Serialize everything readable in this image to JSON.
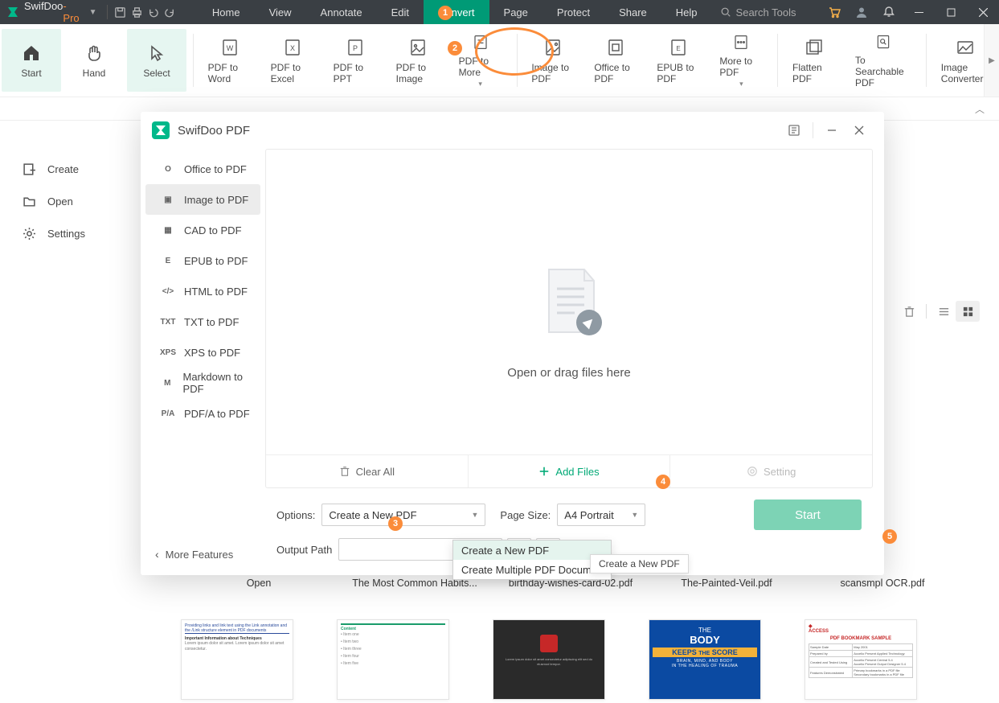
{
  "title": {
    "part1": "SwifDoo",
    "part2": "-Pro"
  },
  "menus": [
    "Home",
    "View",
    "Annotate",
    "Edit",
    "Convert",
    "Page",
    "Protect",
    "Share",
    "Help"
  ],
  "menu_active_index": 4,
  "search_placeholder": "Search Tools",
  "ribbon": {
    "start": "Start",
    "hand": "Hand",
    "select": "Select",
    "items": [
      "PDF to Word",
      "PDF to Excel",
      "PDF to PPT",
      "PDF to Image",
      "PDF to More",
      "Image to PDF",
      "Office to PDF",
      "EPUB to PDF",
      "More to PDF",
      "Flatten PDF",
      "To Searchable PDF",
      "Image Converter"
    ]
  },
  "leftnav": {
    "create": "Create",
    "open": "Open",
    "settings": "Settings"
  },
  "dialog": {
    "title": "SwifDoo PDF",
    "side": [
      "Office to PDF",
      "Image to PDF",
      "CAD to PDF",
      "EPUB to PDF",
      "HTML to PDF",
      "TXT to PDF",
      "XPS to PDF",
      "Markdown to PDF",
      "PDF/A to PDF"
    ],
    "side_icons": [
      "O",
      "▣",
      "▦",
      "E",
      "</>",
      "TXT",
      "XPS",
      "M",
      "P/A"
    ],
    "side_active": 1,
    "drop_msg": "Open or drag files here",
    "clear": "Clear All",
    "add": "Add Files",
    "setting": "Setting",
    "options_label": "Options:",
    "options_value": "Create a New PDF",
    "pagesize_label": "Page Size:",
    "pagesize_value": "A4 Portrait",
    "output_label": "Output Path",
    "dropdown": [
      "Create a New PDF",
      "Create Multiple PDF Document"
    ],
    "tooltip": "Create a New PDF",
    "start": "Start",
    "more_features": "More Features"
  },
  "files": [
    "Open",
    "The Most Common Habits...",
    "birthday-wishes-card-02.pdf",
    "The-Painted-Veil.pdf",
    "scansmpl OCR.pdf"
  ],
  "annot": {
    "1": "1",
    "2": "2",
    "3": "3",
    "4": "4",
    "5": "5"
  }
}
